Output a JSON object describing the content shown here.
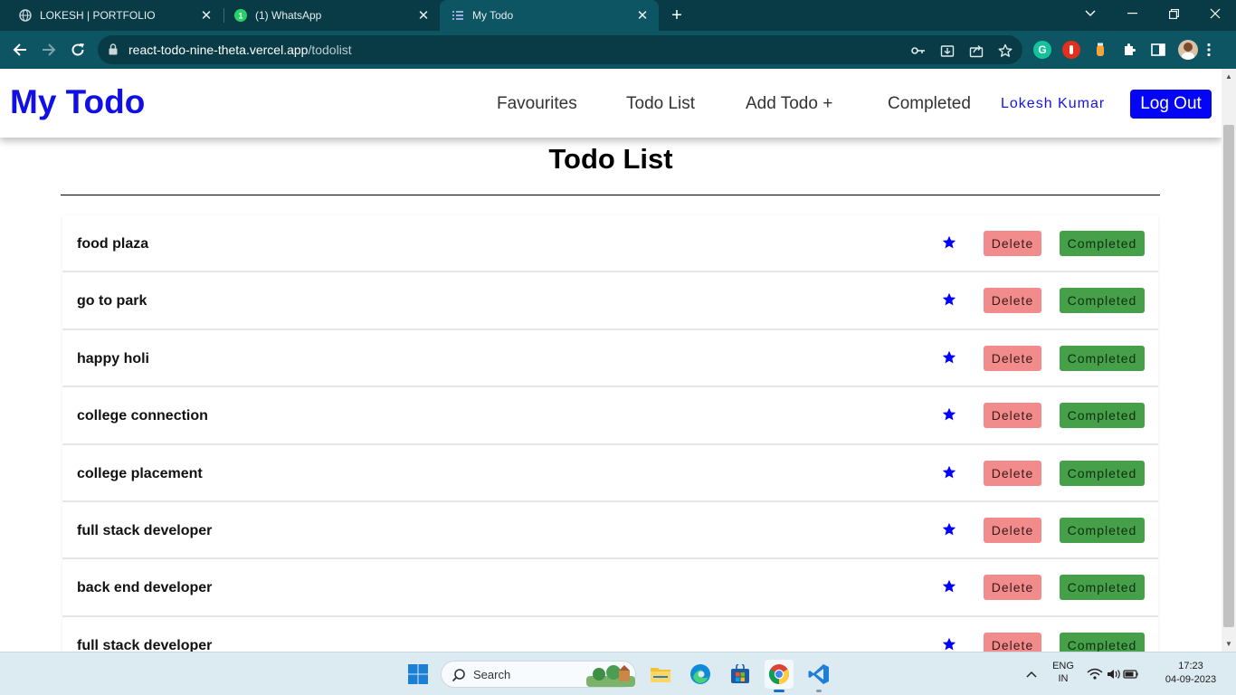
{
  "browser": {
    "tabs": [
      {
        "title": "LOKESH | PORTFOLIO",
        "icon": "globe-icon",
        "active": false
      },
      {
        "title": "(1) WhatsApp",
        "icon": "whatsapp-icon",
        "active": false
      },
      {
        "title": "My Todo",
        "icon": "list-icon",
        "active": true
      }
    ],
    "url_host": "react-todo-nine-theta.vercel.app",
    "url_path": "/todolist"
  },
  "app": {
    "brand": "My Todo",
    "nav": [
      {
        "label": "Favourites"
      },
      {
        "label": "Todo List"
      },
      {
        "label": "Add Todo +"
      },
      {
        "label": "Completed"
      }
    ],
    "user": "Lokesh Kumar",
    "logout_label": "Log Out",
    "colors": {
      "brand": "#1010e6",
      "delete": "#f28b8b",
      "completed": "#45a049",
      "star": "#0000ff"
    }
  },
  "page": {
    "title": "Todo List",
    "delete_label": "Delete",
    "completed_label": "Completed",
    "todos": [
      {
        "name": "food plaza"
      },
      {
        "name": "go to park"
      },
      {
        "name": "happy holi"
      },
      {
        "name": "college connection"
      },
      {
        "name": "college placement"
      },
      {
        "name": "full stack developer"
      },
      {
        "name": "back end developer"
      },
      {
        "name": "full stack developer"
      }
    ]
  },
  "taskbar": {
    "search_label": "Search",
    "lang_line1": "ENG",
    "lang_line2": "IN",
    "time": "17:23",
    "date": "04-09-2023"
  }
}
